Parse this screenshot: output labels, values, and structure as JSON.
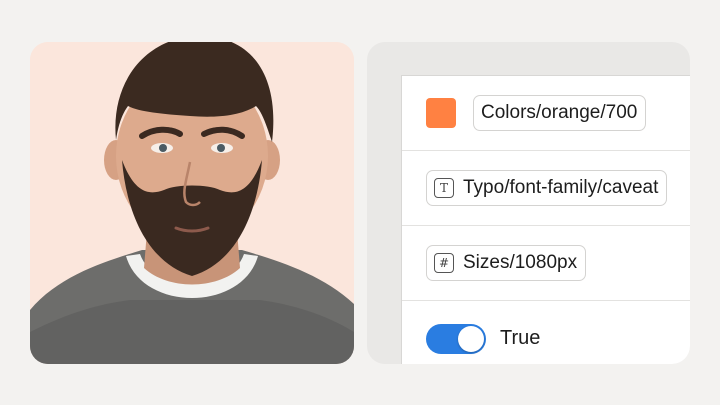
{
  "colors": {
    "page_bg": "#f3f2f0",
    "photo_bg": "#fbe6dc",
    "orange_swatch": "#ff8142",
    "toggle_on": "#2a7de1"
  },
  "variables": [
    {
      "kind": "color",
      "icon": "color-swatch",
      "label": "Colors/orange/700"
    },
    {
      "kind": "string",
      "icon": "text-type-icon",
      "icon_glyph": "T",
      "label": "Typo/font-family/caveat"
    },
    {
      "kind": "number",
      "icon": "number-type-icon",
      "icon_glyph": "#",
      "label": "Sizes/1080px"
    },
    {
      "kind": "boolean",
      "icon": "toggle-switch",
      "value": true,
      "label": "True"
    }
  ]
}
